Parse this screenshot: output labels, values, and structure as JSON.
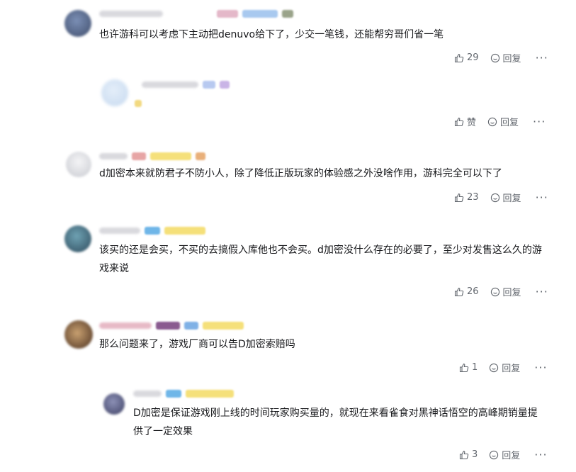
{
  "comments": [
    {
      "text": "也许游科可以考虑下主动把denuvo给下了，少交一笔钱，还能帮穷哥们省一笔",
      "likes": "29",
      "reply_label": "回复"
    },
    {
      "text": "",
      "likes": "赞",
      "reply_label": "回复"
    },
    {
      "text": "d加密本来就防君子不防小人，除了降低正版玩家的体验感之外没啥作用，游科完全可以下了",
      "likes": "23",
      "reply_label": "回复"
    },
    {
      "text": "该买的还是会买，不买的去搞假入库他也不会买。d加密没什么存在的必要了，至少对发售这么久的游戏来说",
      "likes": "26",
      "reply_label": "回复"
    },
    {
      "text": "那么问题来了，游戏厂商可以告D加密索赔吗",
      "likes": "1",
      "reply_label": "回复"
    },
    {
      "text": "D加密是保证游戏刚上线的时间玩家购买量的，就现在来看雀食对黑神话悟空的高峰期销量提供了一定效果",
      "likes": "3",
      "reply_label": "回复"
    }
  ],
  "more_glyph": "···",
  "colors": {
    "text": "#18191c",
    "muted": "#61666d",
    "badge_blue": "#8ec5f5",
    "badge_gold": "#f7d76a",
    "badge_pink": "#f3a6c8"
  }
}
